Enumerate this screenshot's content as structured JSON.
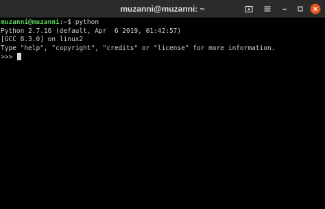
{
  "window": {
    "title": "muzanni@muzanni: ~"
  },
  "titlebar_buttons": [
    {
      "icon": "new-tab-icon"
    },
    {
      "icon": "hamburger-menu-icon"
    },
    {
      "icon": "minimize-icon"
    },
    {
      "icon": "maximize-icon"
    },
    {
      "icon": "close-icon"
    }
  ],
  "terminal": {
    "prompt_user_host": "muzanni@muzanni",
    "prompt_separator": ":",
    "prompt_path": "~",
    "prompt_symbol": "$ ",
    "command": "python",
    "output": [
      "Python 2.7.16 (default, Apr  6 2019, 01:42:57)",
      "[GCC 8.3.0] on linux2",
      "Type \"help\", \"copyright\", \"credits\" or \"license\" for more information."
    ],
    "repl_prompt": ">>> "
  },
  "colors": {
    "background": "#000000",
    "titlebar": "#2b2b2b",
    "text": "#d3d3d3",
    "prompt_user": "#5fd35f",
    "prompt_path": "#6b9bd8",
    "close_button": "#e95420"
  }
}
